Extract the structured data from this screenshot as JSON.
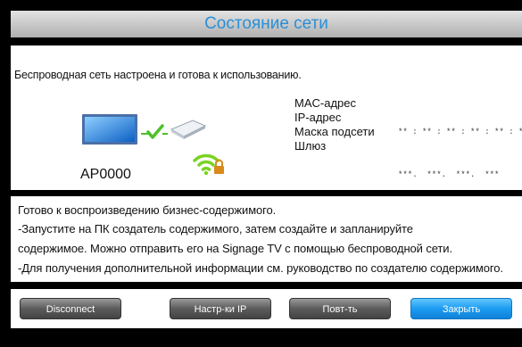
{
  "dialog": {
    "title": "Состояние сети",
    "intro": "Беспроводная сеть настроена и готова к использованию.",
    "ap_name": "AP0000",
    "info": [
      {
        "label": "MAC-адрес",
        "value": "** : ** : ** : ** : ** : **"
      },
      {
        "label": "IP-адрес",
        "value": "***.  ***.  ***.  ***"
      },
      {
        "label": "Маска подсети",
        "value": "***.  ***.  ***.  ***"
      },
      {
        "label": "Шлюз",
        "value": "***.  ***.  ***.  ***"
      }
    ],
    "messages": [
      "Готово к воспроизведению бизнес-содержимого.",
      "-Запустите на ПК создатель содержимого, затем создайте и запланируйте",
      "содержимое.  Можно отправить его на Signage TV с помощью беспроводной сети.",
      "-Для получения дополнительной информации см. руководство по создателю содержимого."
    ],
    "buttons": {
      "disconnect": "Disconnect",
      "ip_settings": "Настр-ки IP",
      "retry": "Повт-ть",
      "close": "Закрыть"
    }
  },
  "colors": {
    "title_text": "#2a8fd6",
    "primary_button": "#1c9bf1",
    "check": "#4cc12a",
    "wifi": "#7ad321"
  },
  "icons": [
    "tv-icon",
    "check-icon",
    "router-icon",
    "wifi-lock-icon"
  ]
}
